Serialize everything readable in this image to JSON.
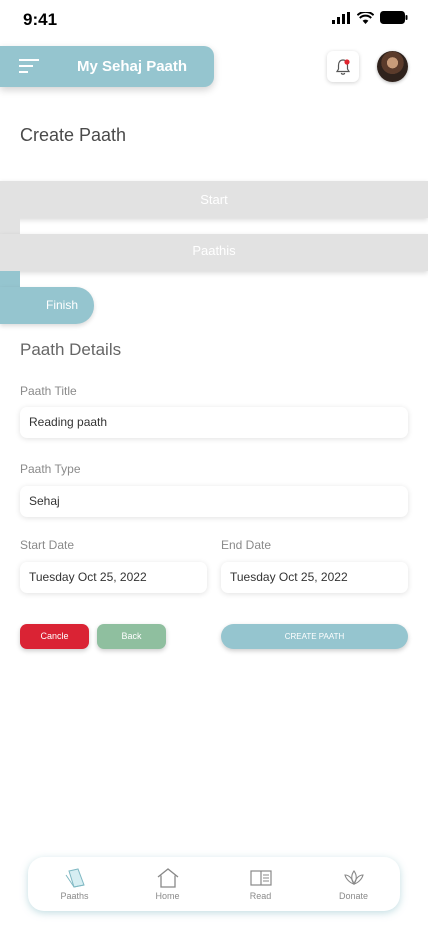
{
  "status_bar": {
    "time": "9:41"
  },
  "header": {
    "title": "My Sehaj Paath"
  },
  "page": {
    "title": "Create Paath"
  },
  "steps": {
    "start": "Start",
    "paathis": "Paathis",
    "finish": "Finish"
  },
  "details": {
    "section_title": "Paath Details",
    "paath_title_label": "Paath Title",
    "paath_title_value": "Reading paath",
    "paath_type_label": "Paath Type",
    "paath_type_value": "Sehaj",
    "start_date_label": "Start Date",
    "start_date_value": "Tuesday Oct 25, 2022",
    "end_date_label": "End Date",
    "end_date_value": "Tuesday Oct 25, 2022"
  },
  "buttons": {
    "cancel": "Cancle",
    "back": "Back",
    "create": "CREATE PAATH"
  },
  "nav": {
    "items": [
      {
        "label": "Paaths",
        "icon": "paaths-icon"
      },
      {
        "label": "Home",
        "icon": "home-icon"
      },
      {
        "label": "Read",
        "icon": "book-icon"
      },
      {
        "label": "Donate",
        "icon": "lotus-icon"
      }
    ]
  },
  "colors": {
    "accent": "#95c5cf",
    "cancel": "#da2334",
    "back": "#8fbf9f",
    "step_inactive": "#e2e2e2"
  }
}
